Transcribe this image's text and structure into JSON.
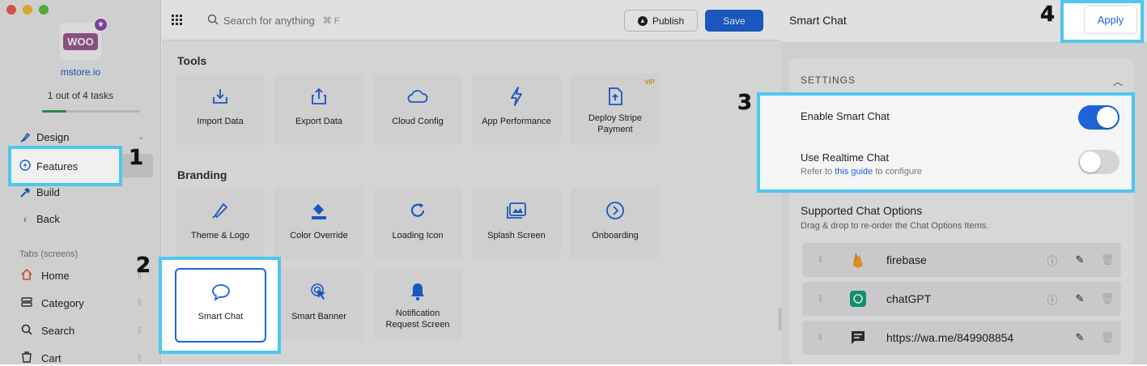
{
  "sidebar": {
    "store_name": "mstore.io",
    "tasks_text": "1 out of 4 tasks",
    "tasks_progress": 0.25,
    "logo_text": "WOO",
    "nav": {
      "design": "Design",
      "features": "Features",
      "build": "Build",
      "back": "Back"
    },
    "tabs_label": "Tabs (screens)",
    "tabs": [
      "Home",
      "Category",
      "Search",
      "Cart"
    ]
  },
  "header": {
    "search_placeholder": "Search for anything",
    "search_shortcut": "⌘ F",
    "publish_label": "Publish",
    "save_label": "Save"
  },
  "tools": {
    "title": "Tools",
    "items": [
      "Import Data",
      "Export Data",
      "Cloud Config",
      "App Performance",
      "Deploy Stripe Payment"
    ],
    "vip_badge": "VIP"
  },
  "branding": {
    "title": "Branding",
    "items": [
      "Theme & Logo",
      "Color Override",
      "Loading Icon",
      "Splash Screen",
      "Onboarding",
      "Smart Chat",
      "Smart Banner",
      "Notification Request Screen"
    ]
  },
  "panel": {
    "title": "Smart Chat",
    "apply_label": "Apply",
    "settings_header": "SETTINGS",
    "enable_label": "Enable Smart Chat",
    "enable_on": true,
    "realtime_label": "Use Realtime Chat",
    "realtime_on": false,
    "realtime_sub_prefix": "Refer to",
    "realtime_sub_link": "this guide",
    "realtime_sub_suffix": "to configure",
    "options_title": "Supported Chat Options",
    "options_sub": "Drag & drop to re-order the Chat Options Items.",
    "options": [
      "firebase",
      "chatGPT",
      "https://wa.me/849908854"
    ]
  },
  "annotations": [
    "1",
    "2",
    "3",
    "4"
  ],
  "colors": {
    "accent": "#1f63d9",
    "highlight": "#4fc6ee",
    "progress": "#2f9b46"
  }
}
